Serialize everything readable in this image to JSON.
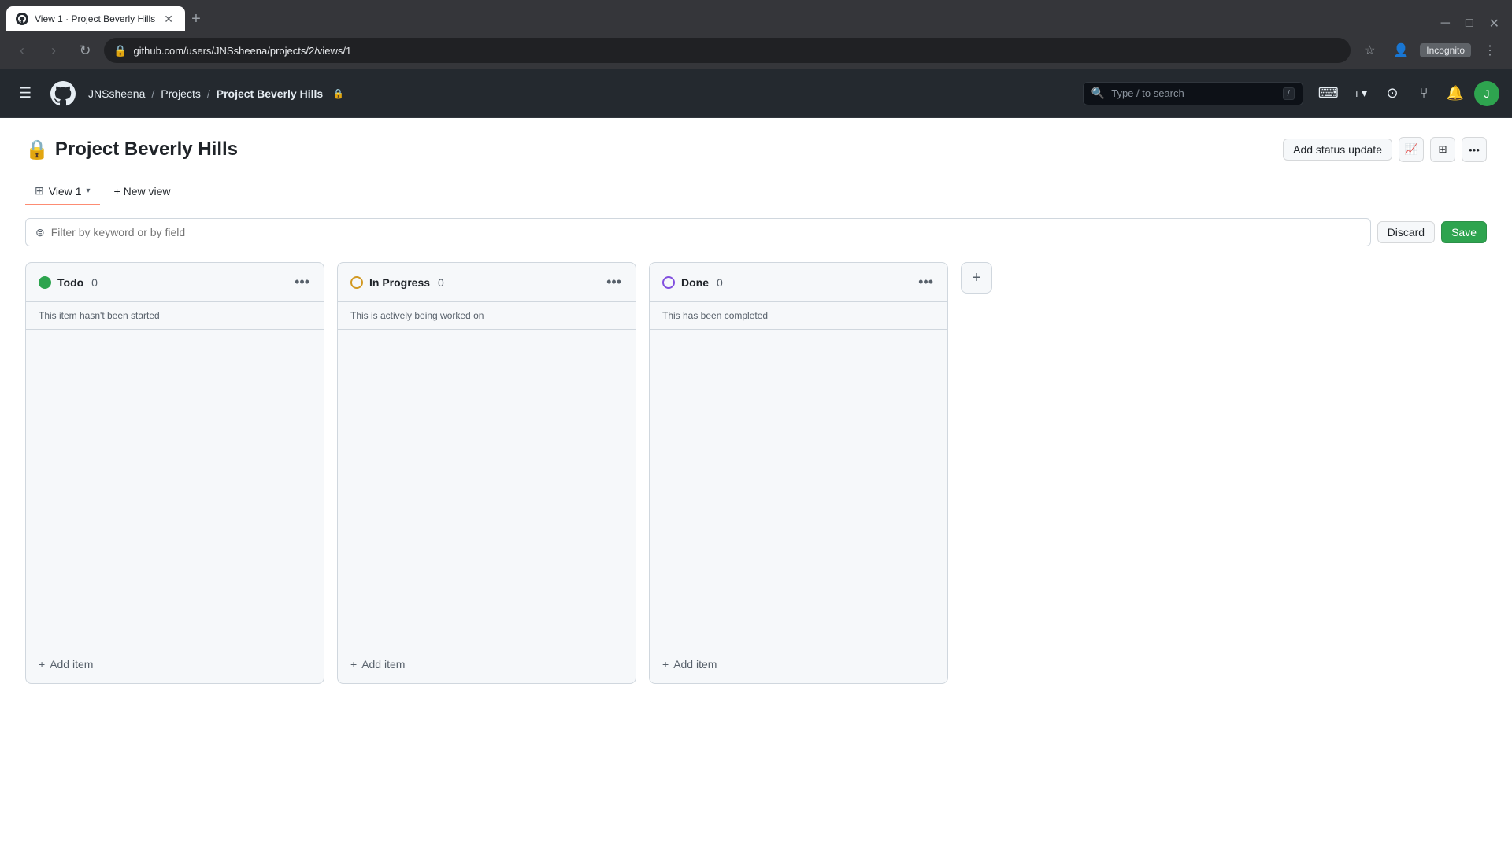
{
  "browser": {
    "tab": {
      "favicon": "github",
      "title": "View 1 · Project Beverly Hills"
    },
    "url": "github.com/users/JNSsheena/projects/2/views/1",
    "nav": {
      "back_disabled": true,
      "forward_disabled": true
    },
    "incognito_label": "Incognito"
  },
  "github": {
    "header": {
      "menu_label": "☰",
      "breadcrumb": {
        "user": "JNSsheena",
        "sep1": "/",
        "projects": "Projects",
        "sep2": "/",
        "project": "Project Beverly Hills",
        "lock": "🔒"
      },
      "search_placeholder": "Type / to search",
      "search_shortcut": "/",
      "plus_label": "+",
      "plus_chevron": "▾"
    },
    "project": {
      "title": "Project Beverly Hills",
      "lock": "🔒",
      "add_status_label": "Add status update",
      "more_options_label": "•••"
    },
    "views": {
      "active_view": {
        "icon": "⊞",
        "label": "View 1",
        "chevron": "▾"
      },
      "new_view_label": "+ New view"
    },
    "filter": {
      "placeholder": "Filter by keyword or by field",
      "discard_label": "Discard",
      "save_label": "Save"
    },
    "columns": [
      {
        "id": "todo",
        "status_class": "status-todo",
        "title": "Todo",
        "count": 0,
        "description": "This item hasn't been started",
        "add_item_label": "+ Add item"
      },
      {
        "id": "in-progress",
        "status_class": "status-in-progress",
        "title": "In Progress",
        "count": 0,
        "description": "This is actively being worked on",
        "add_item_label": "+ Add item"
      },
      {
        "id": "done",
        "status_class": "status-done",
        "title": "Done",
        "count": 0,
        "description": "This has been completed",
        "add_item_label": "+ Add item"
      }
    ],
    "add_column_label": "+"
  }
}
